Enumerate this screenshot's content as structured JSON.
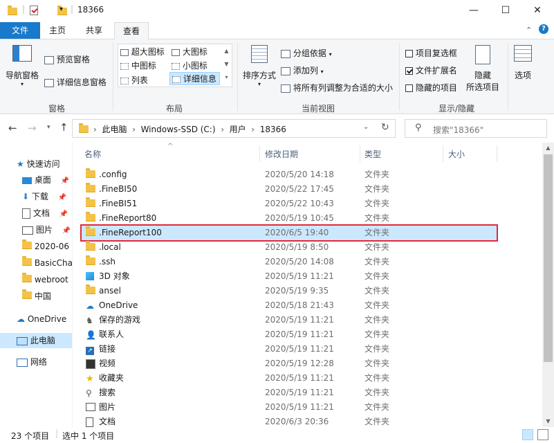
{
  "window": {
    "title": "18366",
    "minimize": "—",
    "maximize": "☐",
    "close": "✕"
  },
  "tabs": [
    {
      "label": "文件"
    },
    {
      "label": "主页"
    },
    {
      "label": "共享"
    },
    {
      "label": "查看"
    }
  ],
  "ribbon": {
    "pane": {
      "nav_pane": "导航窗格",
      "preview": "预览窗格",
      "details": "详细信息窗格",
      "group": "窗格"
    },
    "layout": {
      "items": [
        "超大图标",
        "大图标",
        "中图标",
        "小图标",
        "列表",
        "详细信息"
      ],
      "group": "布局"
    },
    "current_view": {
      "sort": "排序方式",
      "group_by": "分组依据",
      "add_col": "添加列",
      "fit_cols": "将所有列调整为合适的大小",
      "group": "当前视图"
    },
    "show_hide": {
      "item_checkbox": "项目复选框",
      "file_ext": "文件扩展名",
      "hidden_items": "隐藏的项目",
      "hide_selected_1": "隐藏",
      "hide_selected_2": "所选项目",
      "group": "显示/隐藏"
    },
    "options": "选项"
  },
  "address": {
    "parts": [
      "此电脑",
      "Windows-SSD (C:)",
      "用户",
      "18366"
    ]
  },
  "search": {
    "placeholder": "搜索\"18366\""
  },
  "nav": {
    "quick_access": "快速访问",
    "items": [
      "桌面",
      "下载",
      "文档",
      "图片",
      "2020-06",
      "BasicCha",
      "webroot",
      "中国"
    ],
    "onedrive": "OneDrive",
    "this_pc": "此电脑",
    "network": "网络"
  },
  "columns": {
    "name": "名称",
    "date": "修改日期",
    "type": "类型",
    "size": "大小"
  },
  "files": [
    {
      "name": ".config",
      "date": "2020/5/20 14:18",
      "type": "文件夹",
      "icon": "folder"
    },
    {
      "name": ".FineBI50",
      "date": "2020/5/22 17:45",
      "type": "文件夹",
      "icon": "folder"
    },
    {
      "name": ".FineBI51",
      "date": "2020/5/22 10:43",
      "type": "文件夹",
      "icon": "folder"
    },
    {
      "name": ".FineReport80",
      "date": "2020/5/19 10:45",
      "type": "文件夹",
      "icon": "folder"
    },
    {
      "name": ".FineReport100",
      "date": "2020/6/5 19:40",
      "type": "文件夹",
      "icon": "folder",
      "selected": true
    },
    {
      "name": ".local",
      "date": "2020/5/19 8:50",
      "type": "文件夹",
      "icon": "folder"
    },
    {
      "name": ".ssh",
      "date": "2020/5/20 14:08",
      "type": "文件夹",
      "icon": "folder"
    },
    {
      "name": "3D 对象",
      "date": "2020/5/19 11:21",
      "type": "文件夹",
      "icon": "3d"
    },
    {
      "name": "ansel",
      "date": "2020/5/19 9:35",
      "type": "文件夹",
      "icon": "folder"
    },
    {
      "name": "OneDrive",
      "date": "2020/5/18 21:43",
      "type": "文件夹",
      "icon": "cloud"
    },
    {
      "name": "保存的游戏",
      "date": "2020/5/19 11:21",
      "type": "文件夹",
      "icon": "game"
    },
    {
      "name": "联系人",
      "date": "2020/5/19 11:21",
      "type": "文件夹",
      "icon": "contacts"
    },
    {
      "name": "链接",
      "date": "2020/5/19 11:21",
      "type": "文件夹",
      "icon": "link"
    },
    {
      "name": "视频",
      "date": "2020/5/19 12:28",
      "type": "文件夹",
      "icon": "video"
    },
    {
      "name": "收藏夹",
      "date": "2020/5/19 11:21",
      "type": "文件夹",
      "icon": "star"
    },
    {
      "name": "搜索",
      "date": "2020/5/19 11:21",
      "type": "文件夹",
      "icon": "search"
    },
    {
      "name": "图片",
      "date": "2020/5/19 11:21",
      "type": "文件夹",
      "icon": "picture"
    },
    {
      "name": "文档",
      "date": "2020/6/3 20:36",
      "type": "文件夹",
      "icon": "doc"
    }
  ],
  "status": {
    "count": "23 个项目",
    "selected": "选中 1 个项目"
  },
  "colors": {
    "accent": "#1979ca",
    "selection_border": "#e0283c",
    "selection_fill": "#cce8ff",
    "folder": "#f3c348"
  }
}
